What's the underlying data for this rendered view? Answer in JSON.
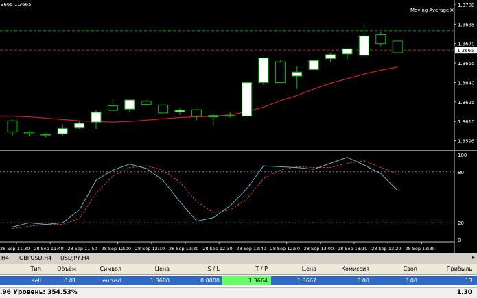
{
  "main_chart": {
    "indicator_label": "Moving Average",
    "close_icon": "close-icon",
    "corner_text": "3665 1.3665",
    "price_tag": "1.3665",
    "price_axis_labels": [
      "1.3700",
      "1.3685",
      "1.3670",
      "1.3655",
      "1.3640",
      "1.3625",
      "1.3610",
      "1.3595"
    ],
    "price_range": [
      1.359,
      1.37
    ],
    "reference_levels": {
      "green_dashed": 1.368,
      "red_dashed": 1.3665
    },
    "candles": [
      {
        "o": 1.36105,
        "h": 1.36115,
        "l": 1.3599,
        "c": 1.3602
      },
      {
        "o": 1.36015,
        "h": 1.36025,
        "l": 1.35985,
        "c": 1.36005
      },
      {
        "o": 1.35995,
        "h": 1.3601,
        "l": 1.35975,
        "c": 1.36
      },
      {
        "o": 1.36005,
        "h": 1.36075,
        "l": 1.3599,
        "c": 1.36045
      },
      {
        "o": 1.3605,
        "h": 1.361,
        "l": 1.3604,
        "c": 1.36085
      },
      {
        "o": 1.36095,
        "h": 1.36185,
        "l": 1.3604,
        "c": 1.3617
      },
      {
        "o": 1.3622,
        "h": 1.3627,
        "l": 1.36185,
        "c": 1.36185
      },
      {
        "o": 1.36195,
        "h": 1.36265,
        "l": 1.3617,
        "c": 1.36265
      },
      {
        "o": 1.36255,
        "h": 1.36265,
        "l": 1.3622,
        "c": 1.3623
      },
      {
        "o": 1.36225,
        "h": 1.3623,
        "l": 1.36155,
        "c": 1.36165
      },
      {
        "o": 1.36175,
        "h": 1.362,
        "l": 1.3615,
        "c": 1.36185
      },
      {
        "o": 1.3619,
        "h": 1.36195,
        "l": 1.3611,
        "c": 1.3614
      },
      {
        "o": 1.36135,
        "h": 1.3616,
        "l": 1.36065,
        "c": 1.36145
      },
      {
        "o": 1.36145,
        "h": 1.3617,
        "l": 1.3613,
        "c": 1.3614
      },
      {
        "o": 1.3614,
        "h": 1.3635,
        "l": 1.3614,
        "c": 1.364
      },
      {
        "o": 1.364,
        "h": 1.36595,
        "l": 1.3638,
        "c": 1.3659
      },
      {
        "o": 1.3656,
        "h": 1.3657,
        "l": 1.364,
        "c": 1.364
      },
      {
        "o": 1.3645,
        "h": 1.36525,
        "l": 1.3635,
        "c": 1.3648
      },
      {
        "o": 1.365,
        "h": 1.3657,
        "l": 1.365,
        "c": 1.3657
      },
      {
        "o": 1.36585,
        "h": 1.3663,
        "l": 1.3656,
        "c": 1.36615
      },
      {
        "o": 1.3662,
        "h": 1.3666,
        "l": 1.3658,
        "c": 1.3666
      },
      {
        "o": 1.3661,
        "h": 1.3685,
        "l": 1.366,
        "c": 1.3676
      },
      {
        "o": 1.3677,
        "h": 1.3679,
        "l": 1.3668,
        "c": 1.367
      },
      {
        "o": 1.3672,
        "h": 1.3672,
        "l": 1.36625,
        "c": 1.3663
      }
    ],
    "ma_values": [
      1.3614,
      1.36135,
      1.36125,
      1.36115,
      1.36105,
      1.361,
      1.36095,
      1.361,
      1.3611,
      1.3612,
      1.3613,
      1.36135,
      1.3614,
      1.3615,
      1.36175,
      1.3621,
      1.3626,
      1.363,
      1.3635,
      1.36395,
      1.3643,
      1.36465,
      1.36495,
      1.3652
    ]
  },
  "osc_chart": {
    "level_labels": [
      "100",
      "80",
      "20",
      "0"
    ],
    "levels": [
      100,
      80,
      20,
      0
    ],
    "main_line": [
      15,
      20,
      18,
      20,
      35,
      70,
      82,
      89,
      84,
      70,
      45,
      22,
      26,
      40,
      60,
      87,
      86,
      85,
      83,
      90,
      97,
      88,
      78,
      58
    ],
    "signal_line": [
      13,
      16,
      18,
      18,
      25,
      55,
      75,
      85,
      87,
      82,
      68,
      45,
      32,
      35,
      48,
      72,
      82,
      86,
      85,
      85,
      90,
      93,
      85,
      78
    ],
    "colors": {
      "main": "#5fb8c8",
      "signal": "#e03c3c"
    }
  },
  "time_axis": {
    "labels": [
      "28 Sep 11:30",
      "28 Sep 11:40",
      "28 Sep 11:50",
      "28 Sep 12:00",
      "28 Sep 12:10",
      "28 Sep 12:20",
      "28 Sep 12:30",
      "28 Sep 12:40",
      "28 Sep 12:50",
      "28 Sep 13:00",
      "28 Sep 13:10",
      "28 Sep 13:20",
      "28 Sep 13:30"
    ]
  },
  "colors": {
    "bull_fill": "#ffffff",
    "bear_fill": "#000000",
    "candle_line": "#00c000",
    "ma": "#d02020",
    "grid": "#404040"
  },
  "tabs": {
    "items": [
      "H4",
      "GBPUSD,H4",
      "USDJPY,H4"
    ],
    "scroll_icon": "scroll-right-icon"
  },
  "terminal": {
    "headers": {
      "type": "Тип",
      "volume": "Объём",
      "symbol": "Символ",
      "price": "Цена",
      "sl": "S / L",
      "tp": "T / P",
      "price2": "Цена",
      "commission": "Комиссия",
      "swap": "Своп",
      "profit": "Прибыль"
    },
    "row": {
      "type": "sell",
      "volume": "0.01",
      "symbol": "eurusd",
      "price": "1.3680",
      "sl": "0.0000",
      "tp": "1.3664",
      "price2": "1.3667",
      "commission": "0.00",
      "swap": "0.00",
      "profit": "13"
    },
    "footer": {
      "left": ".96  Уровень: 354.53%",
      "right": "1.30"
    }
  }
}
